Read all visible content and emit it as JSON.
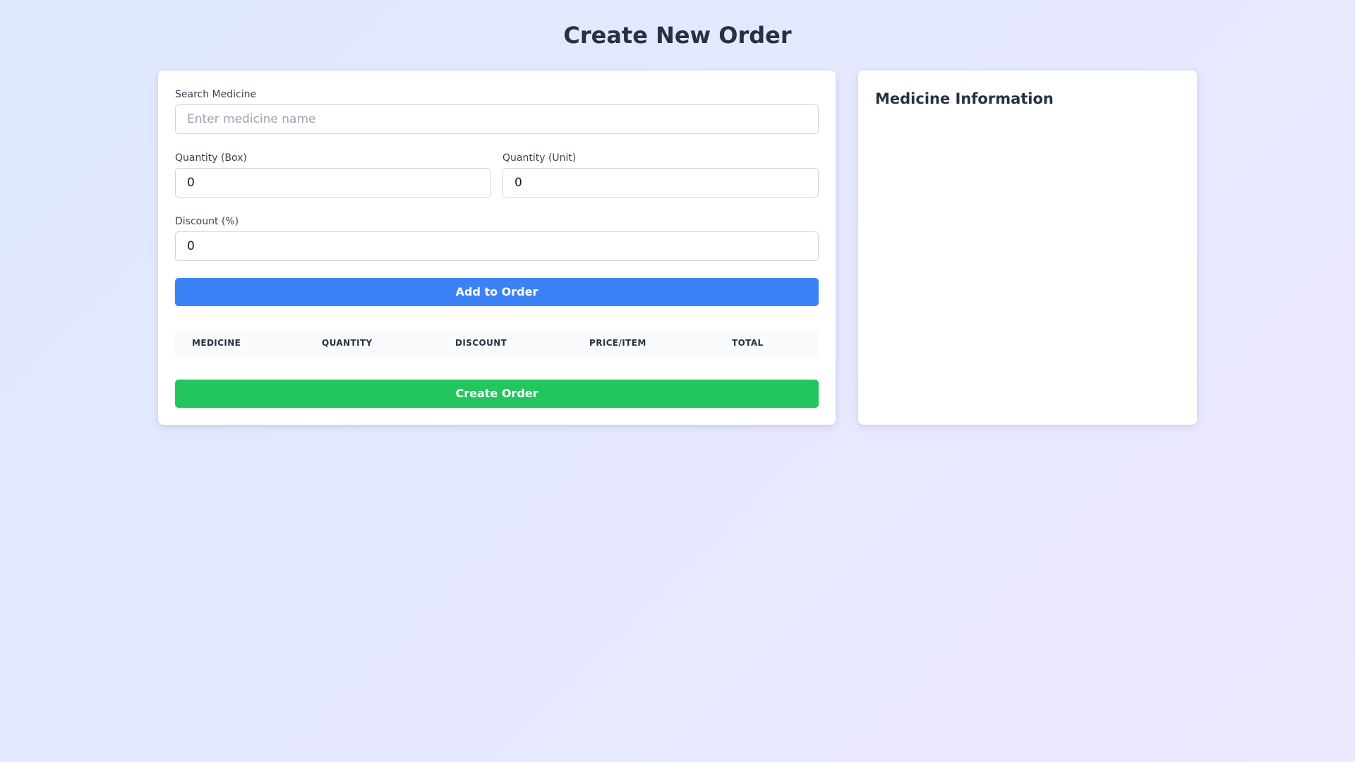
{
  "page": {
    "title": "Create New Order"
  },
  "order_form": {
    "search": {
      "label": "Search Medicine",
      "placeholder": "Enter medicine name",
      "value": ""
    },
    "quantity_box": {
      "label": "Quantity (Box)",
      "value": "0"
    },
    "quantity_unit": {
      "label": "Quantity (Unit)",
      "value": "0"
    },
    "discount": {
      "label": "Discount (%)",
      "value": "0"
    },
    "add_button_label": "Add to Order",
    "create_button_label": "Create Order",
    "table": {
      "columns": [
        "MEDICINE",
        "QUANTITY",
        "DISCOUNT",
        "PRICE/ITEM",
        "TOTAL"
      ],
      "rows": []
    }
  },
  "info_panel": {
    "title": "Medicine Information"
  },
  "colors": {
    "add_button": "#3b82f6",
    "create_button": "#22c55e",
    "text_primary": "#273142"
  }
}
